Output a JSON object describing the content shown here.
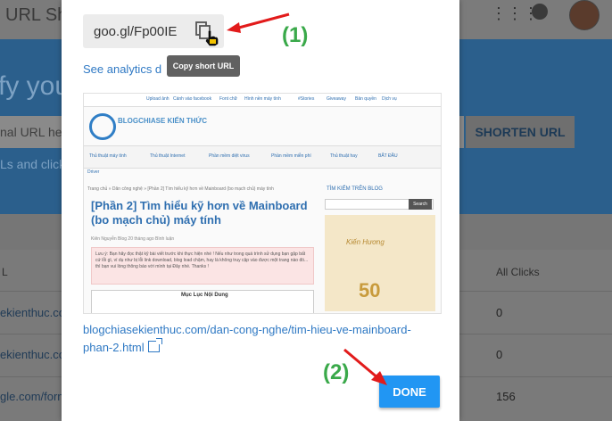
{
  "background": {
    "app_title": "URL Sho",
    "hero_text": "fy you",
    "input_placeholder": "nal URL here",
    "shorten_label": "SHORTEN URL",
    "subtext": "Ls and click",
    "table_headers": [
      "L",
      "All Clicks"
    ],
    "rows": [
      {
        "url": "ekienthuc.co",
        "clicks": "0"
      },
      {
        "url": "ekienthuc.co",
        "clicks": "0"
      },
      {
        "url": "gle.com/form",
        "clicks": "156"
      }
    ]
  },
  "dialog": {
    "short_url": "goo.gl/Fp00IE",
    "copy_tooltip": "Copy short URL",
    "analytics_link": "See analytics d",
    "long_url": "blogchiasekienthuc.com/dan-cong-nghe/tim-hieu-ve-mainboard-phan-2.html",
    "done_label": "DONE",
    "preview": {
      "top_links": [
        "Upload ảnh",
        "Cánh vào facebook",
        "Font chữ",
        "Hình nền máy tính",
        "#Stories",
        "Giveaway",
        "Bản quyền",
        "Dịch vụ"
      ],
      "logo_text": "BLOGCHIASE KIẾN THỨC",
      "nav_items": [
        "Thủ thuật máy tính",
        "Thủ thuật Internet",
        "Phần mềm diệt virus",
        "Phần mềm miễn phí",
        "Thủ thuật hay",
        "BẮT ĐẦU"
      ],
      "nav_driver": "Driver",
      "breadcrumb": "Trang chủ » Dân công nghệ » [Phần 2] Tìm hiểu kỹ hơn về Mainboard (bo mạch chủ) máy tính",
      "title": "[Phần 2] Tìm hiểu kỹ hơn về Mainboard (bo mạch chủ) máy tính",
      "meta": "Kiên Nguyễn Blog   20 tháng ago   Bình luận",
      "note": "Lưu ý: Bạn hãy đọc thật kỹ bài viết trước khi thực hiện nhé ! Nếu như trong quá trình sử dụng bạn gặp bất cứ lỗi gì, ví dụ như bị lỗi link download, blog load chậm, hay là không truy cập vào được một trang nào đó... thì bạn vui lòng thông báo với mình tại Đây nhé. Thanks !",
      "toc_title": "Mục Lục Nội Dung",
      "side_title": "TÌM KIẾM TRÊN BLOG",
      "search_button": "Search",
      "ad_text": "Kiến Hương",
      "ad_number": "50"
    }
  },
  "annotations": {
    "step1": "(1)",
    "step2": "(2)"
  },
  "colors": {
    "annotation_arrow": "#e21b1b",
    "annotation_text": "#3aa94a",
    "done_button": "#2196f3",
    "link": "#2f79c4"
  }
}
